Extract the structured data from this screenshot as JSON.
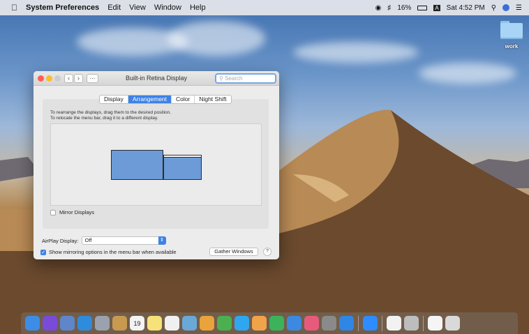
{
  "menubar": {
    "app_name": "System Preferences",
    "menus": [
      "Edit",
      "View",
      "Window",
      "Help"
    ],
    "battery": "16%",
    "input_source": "A",
    "clock": "Sat 4:52 PM"
  },
  "desktop": {
    "folder_label": "work"
  },
  "window": {
    "title": "Built-in Retina Display",
    "search_placeholder": "Search",
    "tabs": [
      "Display",
      "Arrangement",
      "Color",
      "Night Shift"
    ],
    "active_tab": "Arrangement",
    "instructions": [
      "To rearrange the displays, drag them to the desired position.",
      "To relocate the menu bar, drag it to a different display."
    ],
    "mirror_label": "Mirror Displays",
    "mirror_checked": false,
    "airplay_label": "AirPlay Display:",
    "airplay_value": "Off",
    "show_mirroring_label": "Show mirroring options in the menu bar when available",
    "show_mirroring_checked": true,
    "gather_label": "Gather Windows",
    "help_label": "?"
  },
  "dock": {
    "items": [
      {
        "name": "finder-icon",
        "color": "#3d8de4"
      },
      {
        "name": "siri-icon",
        "color": "#7a4ad9"
      },
      {
        "name": "photos-preview-icon",
        "color": "#5f86c9"
      },
      {
        "name": "safari-icon",
        "color": "#2f8bdc"
      },
      {
        "name": "rocket-icon",
        "color": "#9aa2ad"
      },
      {
        "name": "notes-book-icon",
        "color": "#c79a4f"
      },
      {
        "name": "calendar-icon",
        "color": "#f3f3f3",
        "text": "19"
      },
      {
        "name": "notes-icon",
        "color": "#f7e27a"
      },
      {
        "name": "reminders-icon",
        "color": "#f0f0f0"
      },
      {
        "name": "preview-icon",
        "color": "#6aa8d8"
      },
      {
        "name": "photos-icon",
        "color": "#e8a33a"
      },
      {
        "name": "facetime-icon",
        "color": "#4caf50"
      },
      {
        "name": "messages-icon",
        "color": "#2fa7f0"
      },
      {
        "name": "pages-icon",
        "color": "#f1a34a"
      },
      {
        "name": "numbers-icon",
        "color": "#3cb35a"
      },
      {
        "name": "keynote-icon",
        "color": "#3b8ae0"
      },
      {
        "name": "itunes-icon",
        "color": "#e85a7c"
      },
      {
        "name": "system-preferences-icon",
        "color": "#8a8a8a"
      },
      {
        "name": "app-store-icon",
        "color": "#2f86e5"
      },
      {
        "name": "zoom-icon",
        "color": "#2d8cff"
      },
      {
        "name": "textedit-icon",
        "color": "#f2f2f2"
      },
      {
        "name": "installer-icon",
        "color": "#bdbdbd"
      },
      {
        "name": "document-icon",
        "color": "#f5f5f5"
      },
      {
        "name": "trash-icon",
        "color": "#d9d9d9"
      }
    ]
  }
}
